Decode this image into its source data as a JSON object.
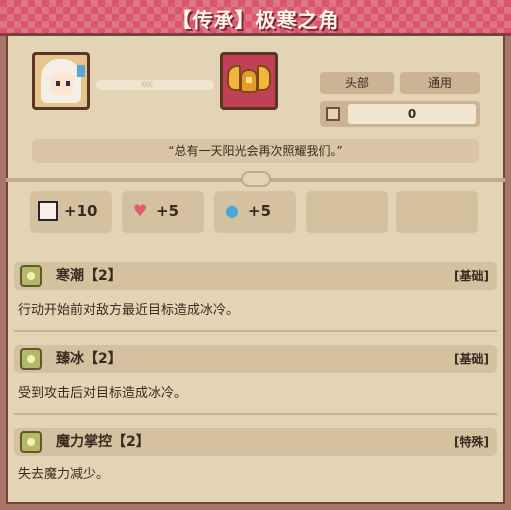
{
  "title": "【传承】极寒之角",
  "hero": {
    "icon": "hero-portrait-icon"
  },
  "item": {
    "icon": "frost-horn-icon"
  },
  "slot_label": "头部",
  "type_label": "通用",
  "quantity": {
    "icon": "inventory-icon",
    "value": "0"
  },
  "quote": "“总有一天阳光会再次照耀我们。”",
  "stats": [
    {
      "icon": "book-icon",
      "value": "+10"
    },
    {
      "icon": "heart-icon",
      "value": "+5"
    },
    {
      "icon": "water-drop-icon",
      "value": "+5"
    }
  ],
  "skills": [
    {
      "name": "寒潮【2】",
      "tag": "[基础]",
      "desc": "行动开始前对敌方最近目标造成冰冷。"
    },
    {
      "name": "臻冰【2】",
      "tag": "[基础]",
      "desc": "受到攻击后对目标造成冰冷。"
    },
    {
      "name": "魔力掌控【2】",
      "tag": "[特殊]",
      "desc": "失去魔力减少。"
    }
  ],
  "colors": {
    "banner": "#d9566d",
    "frame": "#a8756a",
    "panel": "#e3d4b5"
  }
}
